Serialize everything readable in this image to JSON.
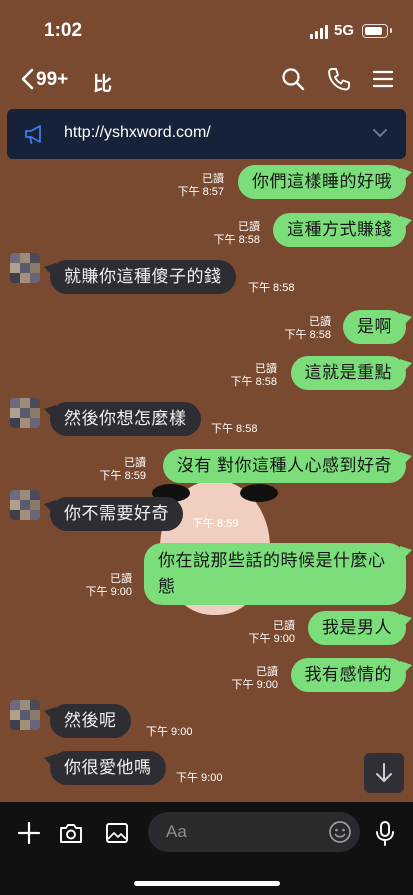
{
  "status": {
    "time": "1:02",
    "network": "5G"
  },
  "header": {
    "unread_count": "99+",
    "chat_name": "比"
  },
  "announcement": {
    "url": "http://yshxword.com/"
  },
  "messages": [
    {
      "dir": "out",
      "text": "你們這樣睡的好哦",
      "read": "已讀",
      "time": "下午 8:57"
    },
    {
      "dir": "out",
      "text": "這種方式賺錢",
      "read": "已讀",
      "time": "下午 8:58"
    },
    {
      "dir": "in",
      "text": "就賺你這種傻子的錢",
      "time": "下午 8:58"
    },
    {
      "dir": "out",
      "text": "是啊",
      "read": "已讀",
      "time": "下午 8:58"
    },
    {
      "dir": "out",
      "text": "這就是重點",
      "read": "已讀",
      "time": "下午 8:58"
    },
    {
      "dir": "in",
      "text": "然後你想怎麼樣",
      "time": "下午 8:58"
    },
    {
      "dir": "out",
      "text": "沒有 對你這種人心感到好奇",
      "read": "已讀",
      "time": "下午 8:59"
    },
    {
      "dir": "in",
      "text": "你不需要好奇",
      "time": "下午 8:59"
    },
    {
      "dir": "out",
      "text": "你在說那些話的時候是什麼心態",
      "read": "已讀",
      "time": "下午 9:00"
    },
    {
      "dir": "out",
      "text": "我是男人",
      "read": "已讀",
      "time": "下午 9:00"
    },
    {
      "dir": "out",
      "text": "我有感情的",
      "read": "已讀",
      "time": "下午 9:00"
    },
    {
      "dir": "in",
      "text": "然後呢",
      "time": "下午 9:00"
    },
    {
      "dir": "in",
      "text": "你很愛他嗎",
      "time": "下午 9:00"
    }
  ],
  "composer": {
    "placeholder": "Aa"
  },
  "colors": {
    "out_bubble": "#7bde7a",
    "in_bubble": "#2d2d33",
    "background": "#7a4a30"
  }
}
